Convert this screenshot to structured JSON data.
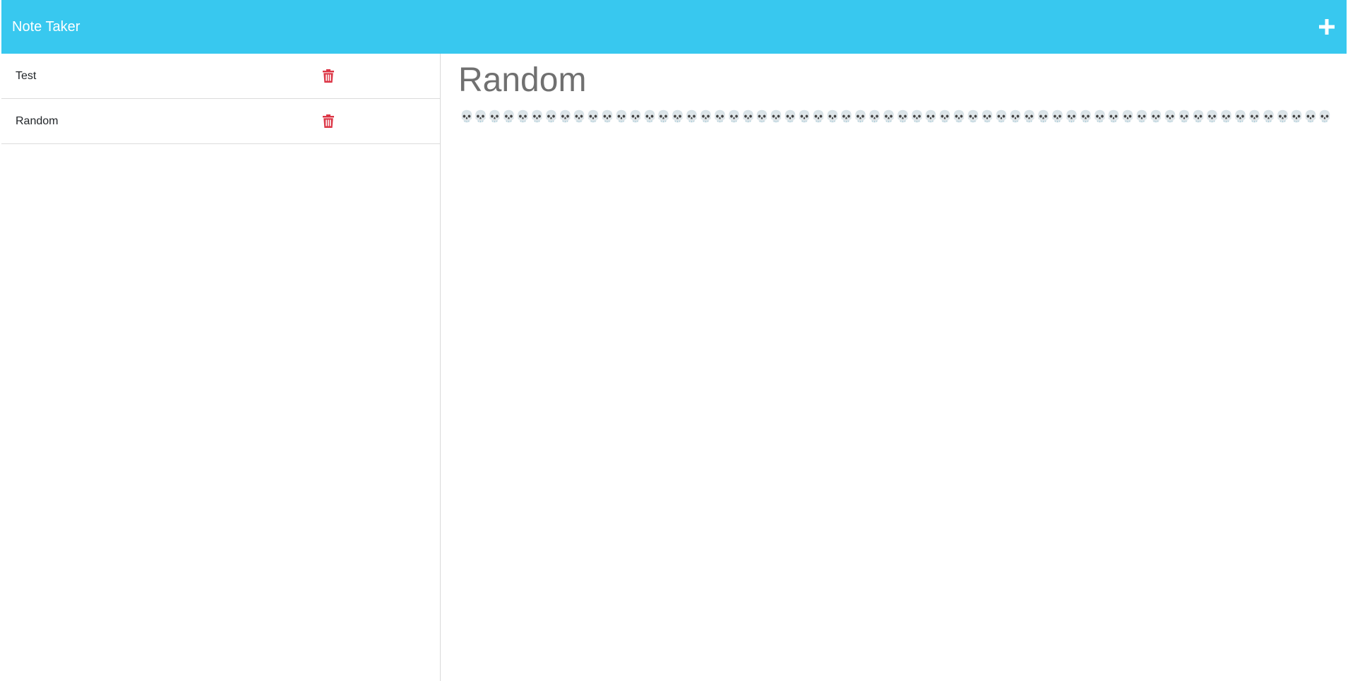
{
  "navbar": {
    "brand": "Note Taker",
    "add_icon": "plus-icon",
    "background": "#38c8ef"
  },
  "sidebar": {
    "notes": [
      {
        "title": "Test",
        "delete_icon": "trash-icon"
      },
      {
        "title": "Random",
        "delete_icon": "trash-icon"
      }
    ]
  },
  "active_note": {
    "title": "Random",
    "body": "💀💀💀💀💀💀💀💀💀💀💀💀💀💀💀💀💀💀💀💀💀💀💀💀💀💀💀💀💀💀💀💀💀💀💀💀💀💀💀💀💀💀💀💀💀💀💀💀💀💀💀💀💀💀💀💀💀💀💀💀💀💀"
  },
  "colors": {
    "accent": "#38c8ef",
    "delete": "#dc3545",
    "heading": "#707070"
  }
}
